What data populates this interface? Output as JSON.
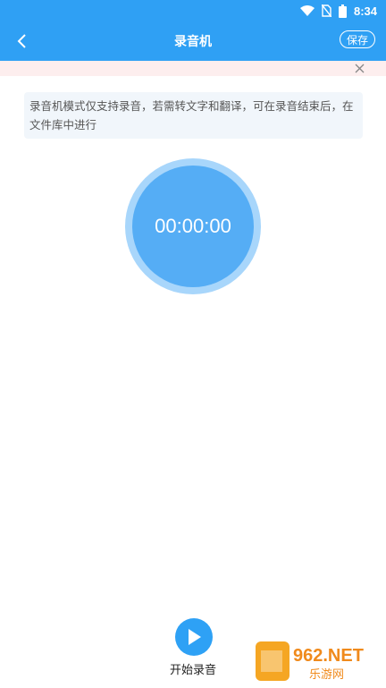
{
  "status_bar": {
    "time": "8:34",
    "icons": [
      "wifi-icon",
      "sim-off-icon",
      "battery-icon"
    ],
    "color": "#2fa0f4"
  },
  "app_bar": {
    "title": "录音机",
    "back_icon": "chevron-left-icon",
    "save_label": "保存"
  },
  "notice": {
    "close_icon": "close-icon"
  },
  "tip": {
    "text": "录音机模式仅支持录音，若需转文字和翻译，可在录音结束后，在文件库中进行"
  },
  "timer": {
    "value": "00:00:00"
  },
  "bottom": {
    "start_label": "开始录音",
    "start_icon": "play-icon"
  },
  "watermark": {
    "brand": "962.NET",
    "sub": "乐游网"
  },
  "colors": {
    "accent": "#2fa0f4",
    "timer_ring": "#a8d6fb",
    "timer_fill": "#55adf5"
  }
}
